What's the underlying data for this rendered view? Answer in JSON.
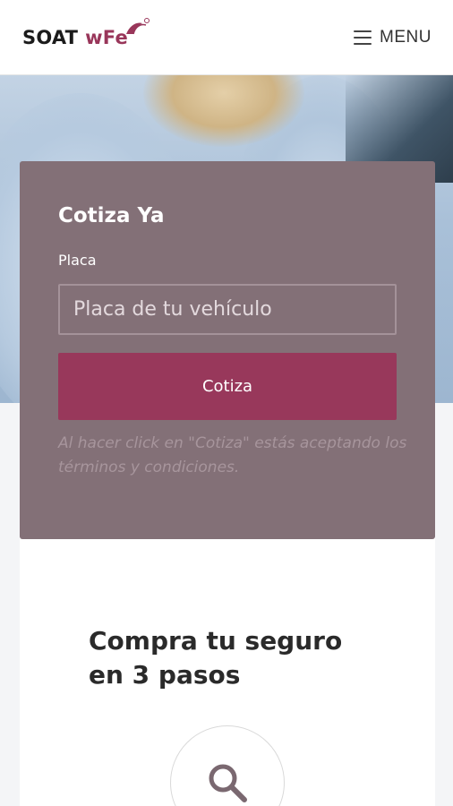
{
  "header": {
    "logo_soat": "SOAT",
    "logo_wfe": "wFe",
    "menu_label": "MENU"
  },
  "quote_card": {
    "title": "Cotiza Ya",
    "plate_label": "Placa",
    "plate_placeholder": "Placa de tu vehículo",
    "plate_value": "",
    "submit_label": "Cotiza",
    "terms_note": "Al hacer click en \"Cotiza\" estás aceptando los términos y condiciones."
  },
  "steps": {
    "title": "Compra tu seguro en 3 pasos",
    "step1_icon": "search-icon"
  },
  "colors": {
    "brand": "#99365a",
    "card_bg": "#837077",
    "button_bg": "#98385b"
  }
}
